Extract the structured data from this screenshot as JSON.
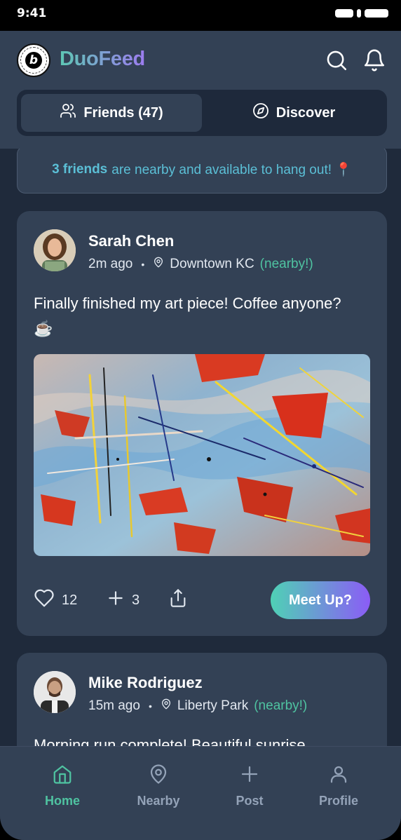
{
  "status_bar": {
    "time": "9:41"
  },
  "header": {
    "app_title": "DuoFeed",
    "logo_letter": "b",
    "logo_ring_text": "POWERED BY BOLT • MADE IN BOLT.NEW •"
  },
  "tabs": [
    {
      "label": "Friends (47)",
      "active": true,
      "icon": "users-icon"
    },
    {
      "label": "Discover",
      "active": false,
      "icon": "compass-icon"
    }
  ],
  "banner": {
    "highlight": "3 friends",
    "text": "are nearby and available to hang out! 📍"
  },
  "posts": [
    {
      "author": "Sarah Chen",
      "time": "2m ago",
      "separator": "•",
      "location": "Downtown KC",
      "nearby": "(nearby!)",
      "text": "Finally finished my art piece! Coffee anyone? ☕",
      "likes": "12",
      "adds": "3",
      "cta": "Meet Up?"
    },
    {
      "author": "Mike Rodriguez",
      "time": "15m ago",
      "separator": "•",
      "location": "Liberty Park",
      "nearby": "(nearby!)",
      "text": "Morning run complete! Beautiful sunrise..."
    }
  ],
  "bottom_nav": [
    {
      "label": "Home",
      "icon": "home-icon",
      "active": true
    },
    {
      "label": "Nearby",
      "icon": "map-pin-icon",
      "active": false
    },
    {
      "label": "Post",
      "icon": "plus-icon",
      "active": false
    },
    {
      "label": "Profile",
      "icon": "user-icon",
      "active": false
    }
  ],
  "colors": {
    "accent": "#4fc3a1",
    "brand_gradient_start": "#5ec7b4",
    "brand_gradient_end": "#9d7cf0",
    "background": "#1f2a3b",
    "surface": "#334155",
    "banner_text": "#5bbfd6"
  }
}
